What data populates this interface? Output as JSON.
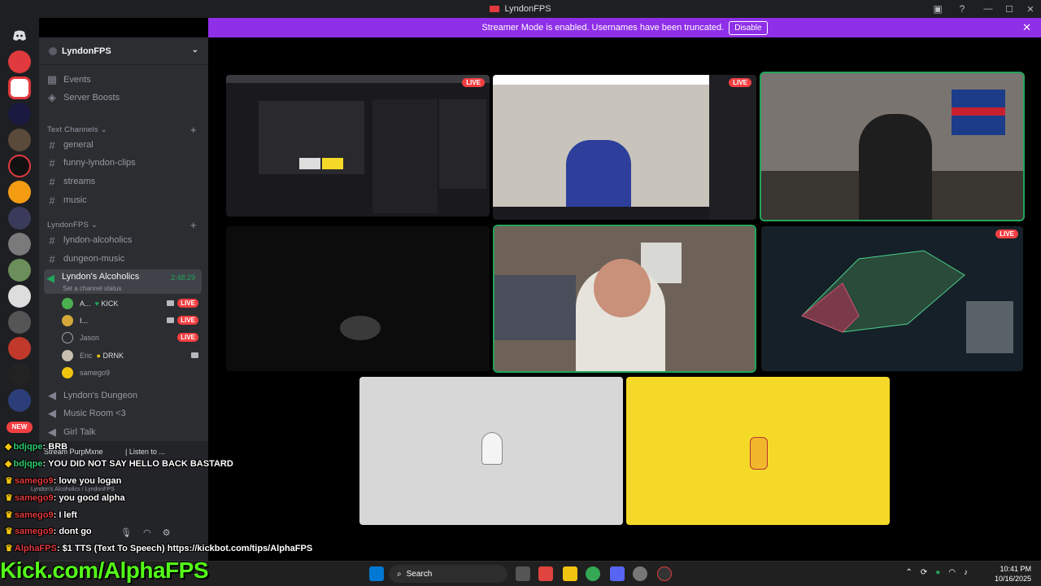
{
  "window": {
    "title": "LyndonFPS",
    "controls": [
      "—",
      "☐",
      "✕"
    ]
  },
  "banner": {
    "text": "Streamer Mode is enabled. Usernames have been truncated.",
    "button": "Disable"
  },
  "guild_bar": {
    "new_badge": "NEW"
  },
  "server": {
    "name": "LyndonFPS"
  },
  "nav": {
    "events": "Events",
    "boosts": "Server Boosts"
  },
  "categories": {
    "text": "Text Channels",
    "lyndon": "LyndonFPS"
  },
  "text_channels": [
    "general",
    "funny-lyndon-clips",
    "streams",
    "music"
  ],
  "lyndon_channels": [
    "lyndon-alcoholics",
    "dungeon-music"
  ],
  "voice": {
    "active_channel": "Lyndon's Alcoholics",
    "timer": "2:48:29",
    "status_placeholder": "Set a channel status",
    "users": [
      {
        "name": "A...",
        "tag": "KICK",
        "live": "LIVE",
        "color": "#4caf50"
      },
      {
        "name": "I...",
        "tag": "",
        "live": "LIVE",
        "color": "#d4a73a"
      },
      {
        "name": "Jason",
        "tag": "",
        "live": "LIVE",
        "color": "#9ea3a8"
      },
      {
        "name": "Eric",
        "tag": "DRNK",
        "live": "",
        "color": "#c8bfb0"
      },
      {
        "name": "samego9",
        "tag": "",
        "live": "",
        "color": "#f1c40f"
      }
    ],
    "other_channels": [
      "Lyndon's Dungeon",
      "Music Room <3",
      "Girl Talk"
    ]
  },
  "tiles": {
    "live_label": "LIVE"
  },
  "chat": [
    {
      "name": "bdjqpe",
      "message": "BRB"
    },
    {
      "name": "bdjqpe",
      "message": "YOU DID NOT SAY HELLO BACK BASTARD"
    },
    {
      "name": "samego9",
      "message": "love you logan"
    },
    {
      "name": "samego9",
      "message": "you good alpha"
    },
    {
      "name": "samego9",
      "message": "I left"
    },
    {
      "name": "samego9",
      "message": "dont go"
    },
    {
      "name": "AlphaFPS",
      "message": "$1 TTS (Text To Speech) https://kickbot.com/tips/AlphaFPS"
    }
  ],
  "ghost_ui": {
    "stream_line": "Stream PurpMxne",
    "listen": "| Listen to ...",
    "vc_line": "Lyndon's Alcoholics / LyndonFPS"
  },
  "kick_url": "Kick.com/AlphaFPS",
  "taskbar": {
    "search": "Search",
    "time": "10:41 PM",
    "date": "10/16/2025"
  }
}
